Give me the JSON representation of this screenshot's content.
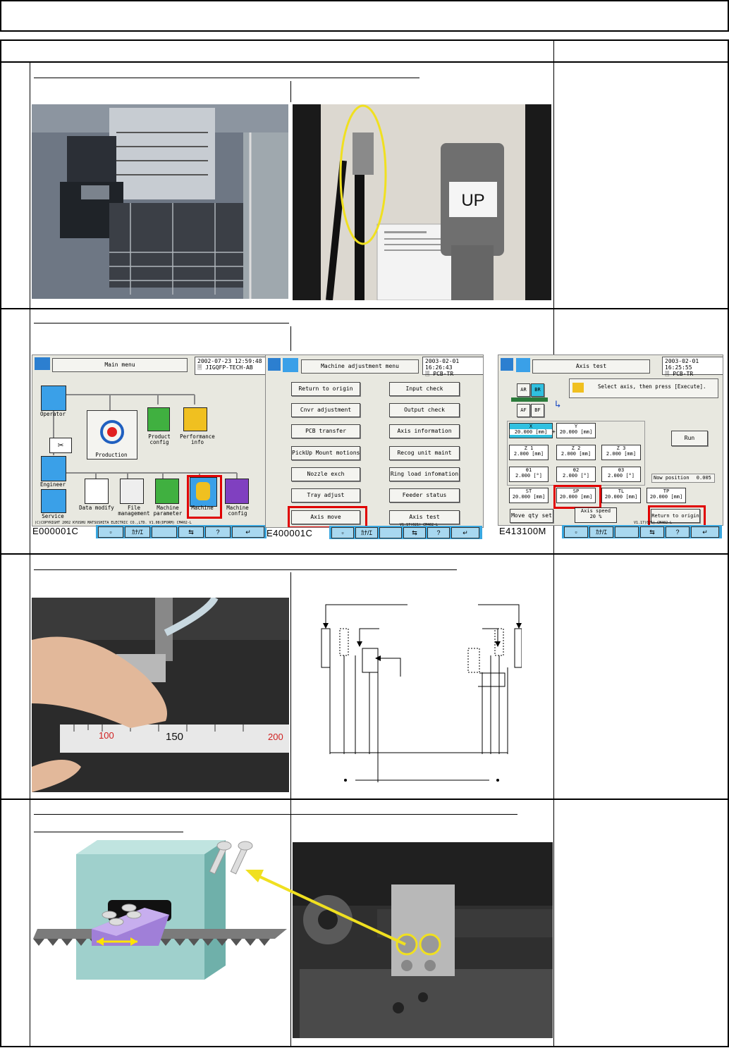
{
  "screens": {
    "main": {
      "title": "Main menu",
      "datetime": "2002-07-23  12:59:48",
      "program": "JIGQFP-TECH-AB",
      "code": "E000001C",
      "copyright": "(C)COPYRIGHT 2002 KYUSHU MATSUSHITA ELECTRIC CO.,LTD.  V1.08(DFORM)  CM402-L",
      "icons": {
        "operator": "Operator",
        "production": "Production",
        "product_config": "Product config",
        "performance_info": "Performance info",
        "engineer": "Engineer",
        "service": "Service",
        "data_modify": "Data modify",
        "file_management": "File management",
        "machine_parameter": "Machine parameter",
        "machine_adjust": "Machine",
        "machine_config": "Machine config"
      }
    },
    "adjust": {
      "title": "Machine adjustment menu",
      "datetime": "2003-02-01  16:26:43",
      "program": "PCB-TR",
      "code": "E400001C",
      "version": "V1.17(021)   CM402-L",
      "left_buttons": [
        "Return to origin",
        "Cnvr adjustment",
        "PCB transfer",
        "PickUp Mount motions",
        "Nozzle exch",
        "Tray adjust",
        "Axis move"
      ],
      "right_buttons": [
        "Input check",
        "Output check",
        "Axis information",
        "Recog unit maint",
        "Ring load infomation",
        "Feeder status",
        "Axis test"
      ]
    },
    "axistest": {
      "title": "Axis test",
      "datetime": "2003-02-01  16:25:55",
      "program": "PCB-TR",
      "code": "E413100M",
      "version": "V1.17(021)   CM402-L",
      "instruction": "Select axis, then press [Execute].",
      "conveyor": {
        "ar": "AR",
        "br": "BR",
        "af": "AF",
        "bf": "BF"
      },
      "run": "Run",
      "axes_row1": [
        {
          "name": "X",
          "value": "20.000",
          "unit": "[mm]"
        },
        {
          "name": "Y",
          "value": "20.000",
          "unit": "[mm]"
        }
      ],
      "axes_row2": [
        {
          "name": "Z 1",
          "value": "2.000",
          "unit": "[mm]"
        },
        {
          "name": "Z 2",
          "value": "2.000",
          "unit": "[mm]"
        },
        {
          "name": "Z 3",
          "value": "2.000",
          "unit": "[mm]"
        }
      ],
      "axes_row3": [
        {
          "name": "θ1",
          "value": "2.000",
          "unit": "[°]"
        },
        {
          "name": "θ2",
          "value": "2.000",
          "unit": "[°]"
        },
        {
          "name": "θ3",
          "value": "2.000",
          "unit": "[°]"
        }
      ],
      "axes_row4": [
        {
          "name": "ST",
          "value": "20.000",
          "unit": "[mm]"
        },
        {
          "name": "SP",
          "value": "20.000",
          "unit": "[mm]"
        },
        {
          "name": "TL",
          "value": "20.000",
          "unit": "[mm]"
        },
        {
          "name": "TP",
          "value": "20.000",
          "unit": "[mm]"
        }
      ],
      "now_position_label": "Now position",
      "now_position_value": "0.005",
      "move_qty": "Move qty set",
      "axis_speed_label": "Axis speed",
      "axis_speed_value": "20  %",
      "return_origin": "Return to origin",
      "plus": "+"
    }
  },
  "fkeys": [
    "",
    "ｶﾅ/ｴ",
    "",
    "",
    "?",
    ""
  ],
  "ruler": {
    "marks": [
      "100",
      "150",
      "200"
    ]
  },
  "photos": {
    "up_label": "UP"
  },
  "colors": {
    "red": "#e00000",
    "yellow": "#f0e020",
    "fkbar": "#39a7e0",
    "screen_bg": "#e8e8e0"
  }
}
